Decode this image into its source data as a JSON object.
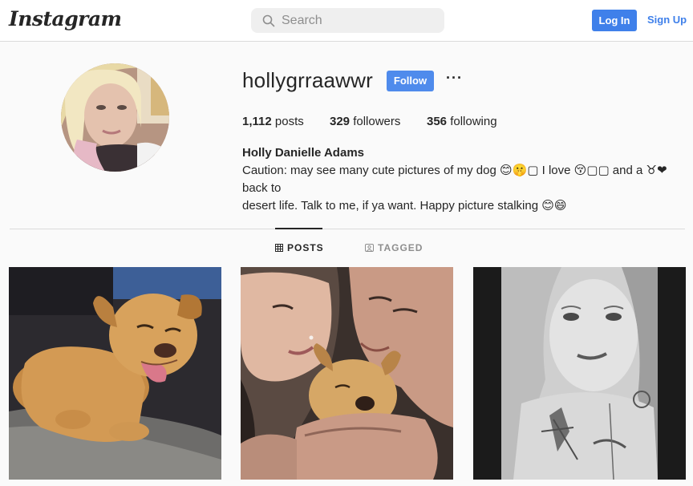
{
  "header": {
    "logo": "Instagram",
    "search_placeholder": "Search",
    "login_label": "Log In",
    "signup_label": "Sign Up"
  },
  "profile": {
    "username": "hollygrraawwr",
    "follow_label": "Follow",
    "more_label": "···",
    "stats": {
      "posts_count": "1,112",
      "posts_label": "posts",
      "followers_count": "329",
      "followers_label": "followers",
      "following_count": "356",
      "following_label": "following"
    },
    "full_name": "Holly Danielle Adams",
    "bio_line1": "Caution: may see many cute pictures of my dog 😊🤫▢ I love 😚▢▢ and a ♉❤ back to",
    "bio_line2": "desert life. Talk to me, if ya want. Happy picture stalking 😊😄"
  },
  "tabs": [
    {
      "label": "POSTS",
      "icon": "grid-icon",
      "active": true
    },
    {
      "label": "TAGGED",
      "icon": "tag-icon",
      "active": false
    }
  ],
  "posts": [
    {
      "subject": "dog-in-sunlight"
    },
    {
      "subject": "couple-kissing-dog"
    },
    {
      "subject": "black-and-white-selfie"
    }
  ],
  "colors": {
    "accent": "#3f80ea",
    "follow": "#4f8bec",
    "border": "#dbdbdb",
    "background": "#fafafa",
    "text": "#262626",
    "muted": "#8e8e8e"
  }
}
